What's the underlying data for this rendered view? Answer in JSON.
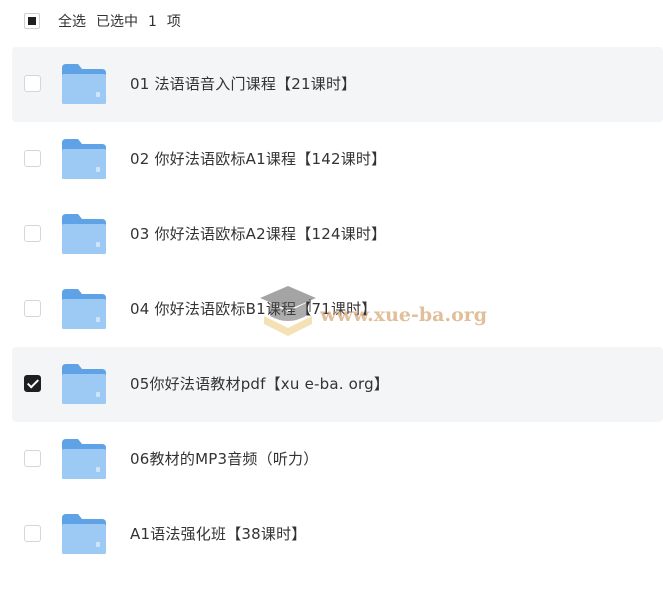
{
  "header": {
    "select_all_label": "全选",
    "selected_text": "已选中",
    "selected_count": "1",
    "unit_text": "项"
  },
  "files": [
    {
      "name": "01 法语语音入门课程【21课时】",
      "checked": false,
      "highlighted": true
    },
    {
      "name": "02 你好法语欧标A1课程【142课时】",
      "checked": false,
      "highlighted": false
    },
    {
      "name": "03 你好法语欧标A2课程【124课时】",
      "checked": false,
      "highlighted": false
    },
    {
      "name": "04 你好法语欧标B1课程【71课时】",
      "checked": false,
      "highlighted": false
    },
    {
      "name": "05你好法语教材pdf【xu e-ba. org】",
      "checked": true,
      "highlighted": true
    },
    {
      "name": "06教材的MP3音频（听力）",
      "checked": false,
      "highlighted": false
    },
    {
      "name": "A1语法强化班【38课时】",
      "checked": false,
      "highlighted": false
    }
  ],
  "watermark": {
    "text": "www.xue-ba.org"
  },
  "colors": {
    "folder_back": "#5fa3e6",
    "folder_front": "#9ccaf5",
    "highlight_row": "#f4f5f7",
    "checkbox_checked": "#1f1f1f"
  }
}
